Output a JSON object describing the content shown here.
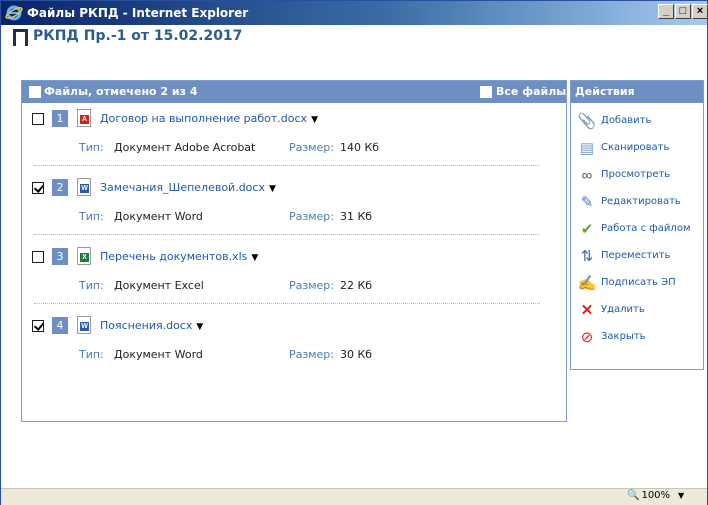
{
  "window": {
    "title": "Файлы РКПД - Internet Explorer",
    "min_glyph": "_",
    "max_glyph": "□",
    "close_glyph": "×"
  },
  "doc": {
    "title": "РКПД Пр.-1 от 15.02.2017"
  },
  "files_panel": {
    "header": "Файлы, отмечено 2 из 4",
    "all_files_label": "Все файлы",
    "type_label": "Тип:",
    "size_label": "Размер:"
  },
  "files": [
    {
      "num": "1",
      "checked": false,
      "icon": "pdf-icon",
      "name": "Договор на выполнение работ.docx",
      "type": "Документ Adobe Acrobat",
      "size": "140 Кб"
    },
    {
      "num": "2",
      "checked": true,
      "icon": "word-icon",
      "name": "Замечания_Шепелевой.docx",
      "type": "Документ Word",
      "size": "31 Кб"
    },
    {
      "num": "3",
      "checked": false,
      "icon": "excel-icon",
      "name": "Перечень документов.xls",
      "type": "Документ Excel",
      "size": "22 Кб"
    },
    {
      "num": "4",
      "checked": true,
      "icon": "word-icon",
      "name": "Пояснения.docx",
      "type": "Документ Word",
      "size": "30 Кб"
    }
  ],
  "actions": {
    "header": "Действия",
    "items": [
      {
        "icon": "add-icon",
        "label": "Добавить"
      },
      {
        "icon": "scan-icon",
        "label": "Сканировать"
      },
      {
        "icon": "view-icon",
        "label": "Просмотреть"
      },
      {
        "icon": "edit-icon",
        "label": "Редактировать"
      },
      {
        "icon": "work-file-icon",
        "label": "Работа с файлом"
      },
      {
        "icon": "move-icon",
        "label": "Переместить"
      },
      {
        "icon": "sign-icon",
        "label": "Подписать ЭП"
      },
      {
        "icon": "delete-icon",
        "label": "Удалить"
      },
      {
        "icon": "close-icon",
        "label": "Закрыть"
      }
    ]
  },
  "statusbar": {
    "zoom": "100%"
  },
  "colors": {
    "accent": "#6f8fc2",
    "link": "#1f58a8",
    "title": "#2a5d8f"
  }
}
